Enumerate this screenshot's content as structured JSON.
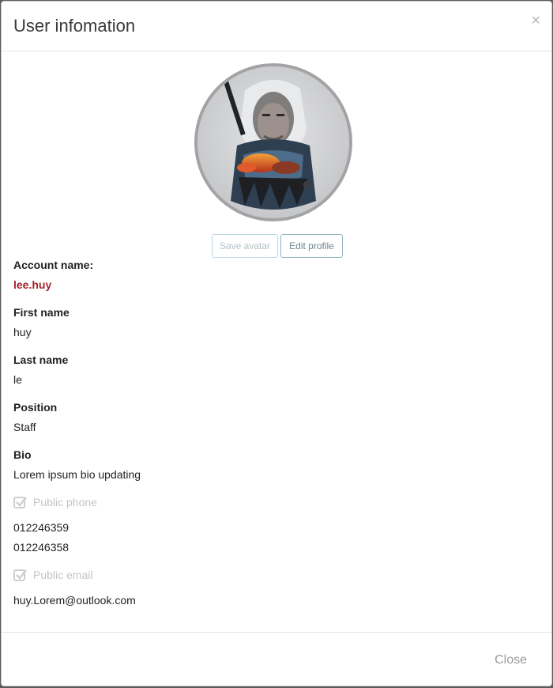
{
  "modal": {
    "title": "User infomation",
    "close_symbol": "×"
  },
  "avatar": {
    "description": "avatar-image",
    "border_color": "#a3a3a3"
  },
  "buttons": {
    "save_avatar": "Save avatar",
    "edit_profile": "Edit profile"
  },
  "fields": {
    "account_name": {
      "label": "Account name:",
      "value": "lee.huy"
    },
    "first_name": {
      "label": "First name",
      "value": "huy"
    },
    "last_name": {
      "label": "Last name",
      "value": "le"
    },
    "position": {
      "label": "Position",
      "value": "Staff"
    },
    "bio": {
      "label": "Bio",
      "value": "Lorem ipsum bio updating"
    }
  },
  "public_phone": {
    "label": "Public phone",
    "checked": true,
    "phones": [
      "012246359",
      "012246358"
    ]
  },
  "public_email": {
    "label": "Public email",
    "checked": true,
    "email": "huy.Lorem@outlook.com"
  },
  "footer": {
    "close_label": "Close"
  },
  "colors": {
    "accent_account": "#a3242c",
    "button_border": "#8fb5bf",
    "disabled_text": "#c4c4c4"
  },
  "icons": [
    "close-icon",
    "checkbox-checked-icon"
  ]
}
